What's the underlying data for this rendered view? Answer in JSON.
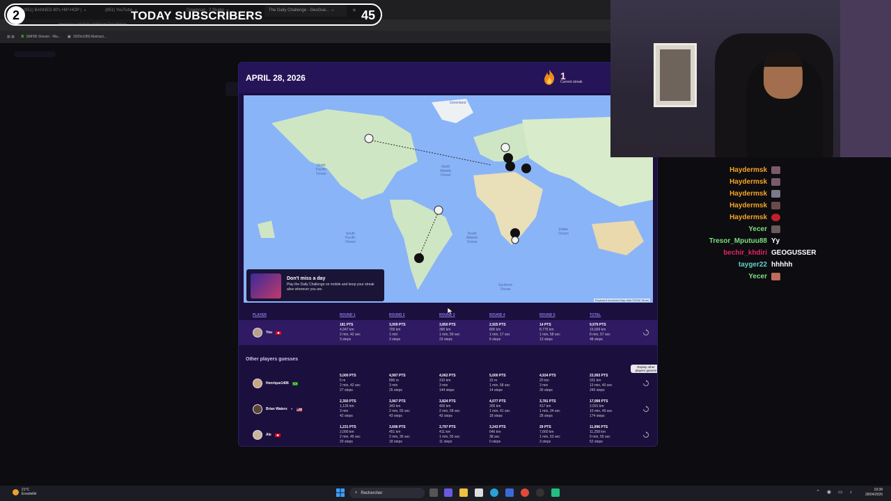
{
  "browser": {
    "tabs": [
      {
        "label": "(851) BANNED 80's HIP-HOP |",
        "close": "×",
        "active": false
      },
      {
        "label": "(851) YouTube",
        "close": "×",
        "active": false
      },
      {
        "label": "Download - 2 Studio",
        "close": "×",
        "active": false
      },
      {
        "label": "The Daily Challenge - GeoGue...",
        "close": "×",
        "active": true
      }
    ],
    "new_tab": "+",
    "url": "geoguessr.com/daily-challenges?result=true",
    "bookmarks": [
      "SMF86 Stream - Wa...",
      "1920x1080 Abstract..."
    ]
  },
  "overlay": {
    "badge": "2",
    "title": "TODAY SUBSCRIBERS",
    "count": "45"
  },
  "game": {
    "date": "APRIL 28, 2026",
    "streak_count": "1",
    "streak_label": "Current streak",
    "map_labels": {
      "greenland": "Greenland",
      "north_pacific": "North\nPacific\nOcean",
      "north_atlantic": "North\nAtlantic\nOcean",
      "south_pacific": "South\nPacific\nOcean",
      "south_atlantic": "South\nAtlantic\nOcean",
      "indian": "Indian\nOcean",
      "southern": "Southern\nOcean"
    },
    "promo": {
      "title": "Don't miss a day",
      "text": "Play the Daily Challenge on mobile and keep your streak alive wherever you are."
    },
    "attribution": "Keyboard shortcuts   Map data ©2026   Terms",
    "columns": [
      "PLAYER",
      "ROUND 1",
      "ROUND 2",
      "ROUND 3",
      "ROUND 4",
      "ROUND 5",
      "TOTAL"
    ],
    "you": {
      "name": "You",
      "cells": [
        {
          "pts": "181 PTS",
          "l1": "4,947 km",
          "l2": "2 min, 42 sec",
          "l3": "3 steps"
        },
        {
          "pts": "3,009 PTS",
          "l1": "709 km",
          "l2": "1 min",
          "l3": "3 steps"
        },
        {
          "pts": "3,850 PTS",
          "l1": "390 km",
          "l2": "1 min, 59 sec",
          "l3": "23 steps"
        },
        {
          "pts": "2,925 PTS",
          "l1": "800 km",
          "l2": "1 min, 17 sec",
          "l3": "6 steps"
        },
        {
          "pts": "14 PTS",
          "l1": "8,775 km",
          "l2": "1 min, 58 sec",
          "l3": "13 steps"
        },
        {
          "pts": "9,979 PTS",
          "l1": "15,669 km",
          "l2": "8 min, 57 sec",
          "l3": "48 steps"
        }
      ]
    },
    "others_title": "Other players guesses",
    "replay_tooltip": "Replay other players games!",
    "others": [
      {
        "name": "Henrique1406",
        "cells": [
          {
            "pts": "5,000 PTS",
            "l1": "6 m",
            "l2": "2 min, 42 sec",
            "l3": "27 steps"
          },
          {
            "pts": "4,997 PTS",
            "l1": "896 m",
            "l2": "3 min",
            "l3": "25 steps"
          },
          {
            "pts": "4,062 PTS",
            "l1": "310 km",
            "l2": "3 min",
            "l3": "144 steps"
          },
          {
            "pts": "5,000 PTS",
            "l1": "15 m",
            "l2": "1 min, 58 sec",
            "l3": "14 steps"
          },
          {
            "pts": "4,934 PTS",
            "l1": "20 km",
            "l2": "3 min",
            "l3": "30 steps"
          },
          {
            "pts": "23,993 PTS",
            "l1": "331 km",
            "l2": "13 min, 40 sec",
            "l3": "240 steps"
          }
        ]
      },
      {
        "name": "Brian Waters",
        "cells": [
          {
            "pts": "2,350 PTS",
            "l1": "1,126 km",
            "l2": "3 min",
            "l3": "42 steps"
          },
          {
            "pts": "3,967 PTS",
            "l1": "343 km",
            "l2": "2 min, 55 sec",
            "l3": "43 steps"
          },
          {
            "pts": "3,824 PTS",
            "l1": "400 km",
            "l2": "2 min, 58 sec",
            "l3": "43 steps"
          },
          {
            "pts": "4,077 PTS",
            "l1": "305 km",
            "l2": "1 min, 41 sec",
            "l3": "18 steps"
          },
          {
            "pts": "3,781 PTS",
            "l1": "417 km",
            "l2": "1 min, 34 sec",
            "l3": "28 steps"
          },
          {
            "pts": "17,999 PTS",
            "l1": "2,591 km",
            "l2": "10 min, 49 sec",
            "l3": "174 steps"
          }
        ]
      },
      {
        "name": "Ale",
        "cells": [
          {
            "pts": "1,231 PTS",
            "l1": "2,090 km",
            "l2": "2 min, 45 sec",
            "l3": "20 steps"
          },
          {
            "pts": "3,696 PTS",
            "l1": "451 km",
            "l2": "2 min, 36 sec",
            "l3": "18 steps"
          },
          {
            "pts": "3,797 PTS",
            "l1": "411 km",
            "l2": "1 min, 55 sec",
            "l3": "11 steps"
          },
          {
            "pts": "3,243 PTS",
            "l1": "646 km",
            "l2": "38 sec",
            "l3": "0 steps"
          },
          {
            "pts": "29 PTS",
            "l1": "7,660 km",
            "l2": "1 min, 53 sec",
            "l3": "3 steps"
          },
          {
            "pts": "11,996 PTS",
            "l1": "11,258 km",
            "l2": "9 min, 55 sec",
            "l3": "52 steps"
          }
        ]
      }
    ]
  },
  "chat": [
    {
      "name": "Haydermsk",
      "color": "#f5a623",
      "msg": ""
    },
    {
      "name": "Haydermsk",
      "color": "#f5a623",
      "msg": ""
    },
    {
      "name": "Haydermsk",
      "color": "#f5a623",
      "msg": ""
    },
    {
      "name": "Haydermsk",
      "color": "#f5a623",
      "msg": ""
    },
    {
      "name": "Haydermsk",
      "color": "#f5a623",
      "msg": ""
    },
    {
      "name": "Yecer",
      "color": "#7be07b",
      "msg": ""
    },
    {
      "name": "Tresor_Mputuu88",
      "color": "#7be07b",
      "msg": "Yy"
    },
    {
      "name": "bechir_khdiri",
      "color": "#e0245e",
      "msg": "GEOGUSSER"
    },
    {
      "name": "tayger22",
      "color": "#5fd3c9",
      "msg": "hhhhh"
    },
    {
      "name": "Yecer",
      "color": "#7be07b",
      "msg": ""
    }
  ],
  "taskbar": {
    "weather_temp": "21°C",
    "weather_text": "Ensoleillé",
    "search": "Rechercher",
    "time": "19:38",
    "date": "28/04/2026"
  }
}
